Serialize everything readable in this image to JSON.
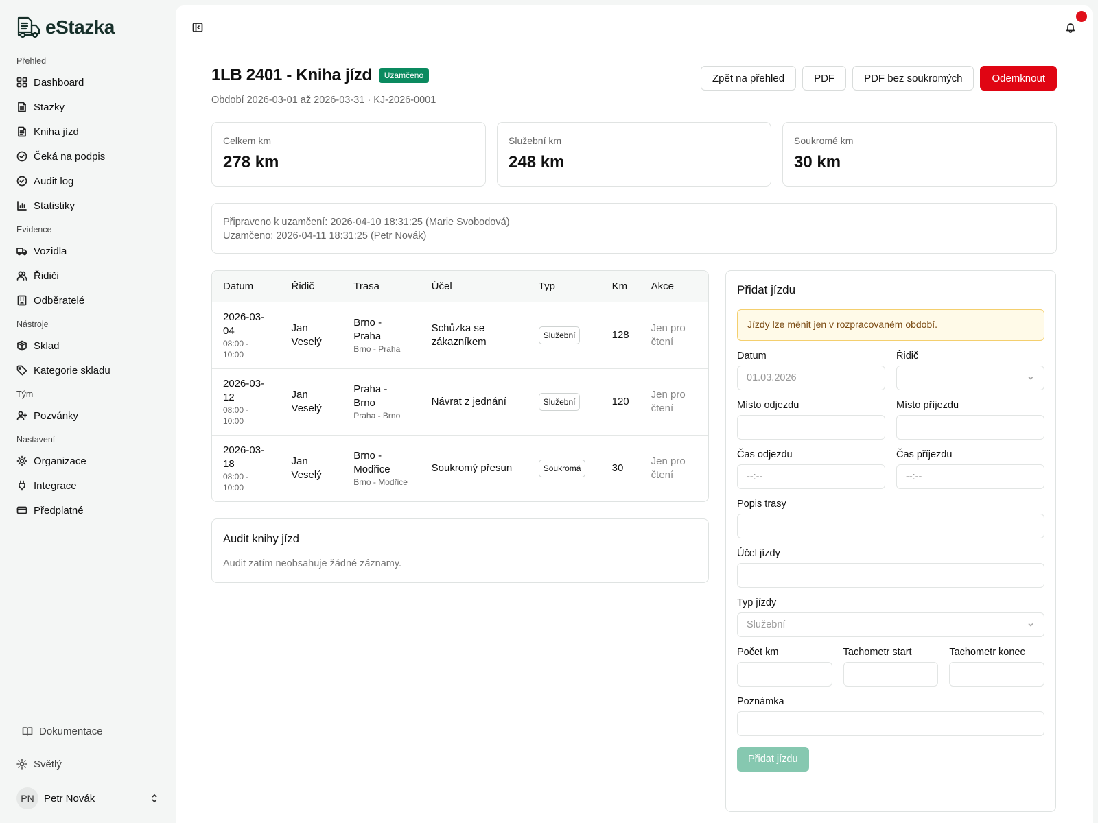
{
  "brand": {
    "name": "eStazka"
  },
  "sidebar": {
    "groups": [
      {
        "label": "Přehled",
        "items": [
          {
            "label": "Dashboard",
            "icon": "grid-icon"
          },
          {
            "label": "Stazky",
            "icon": "file-icon"
          },
          {
            "label": "Kniha jízd",
            "icon": "file-text-icon"
          },
          {
            "label": "Čeká na podpis",
            "icon": "check-circle-icon"
          },
          {
            "label": "Audit log",
            "icon": "check-circle-icon"
          },
          {
            "label": "Statistiky",
            "icon": "bar-chart-icon"
          }
        ]
      },
      {
        "label": "Evidence",
        "items": [
          {
            "label": "Vozidla",
            "icon": "truck-icon"
          },
          {
            "label": "Řidiči",
            "icon": "users-icon"
          },
          {
            "label": "Odběratelé",
            "icon": "building-icon"
          }
        ]
      },
      {
        "label": "Nástroje",
        "items": [
          {
            "label": "Sklad",
            "icon": "package-icon"
          },
          {
            "label": "Kategorie skladu",
            "icon": "tag-icon"
          }
        ]
      },
      {
        "label": "Tým",
        "items": [
          {
            "label": "Pozvánky",
            "icon": "user-plus-icon"
          }
        ]
      },
      {
        "label": "Nastavení",
        "items": [
          {
            "label": "Organizace",
            "icon": "gear-icon"
          },
          {
            "label": "Integrace",
            "icon": "plug-icon"
          },
          {
            "label": "Předplatné",
            "icon": "credit-card-icon"
          }
        ]
      }
    ],
    "docs_label": "Dokumentace",
    "theme_label": "Světlý",
    "user": {
      "initials": "PN",
      "name": "Petr Novák"
    }
  },
  "page": {
    "title": "1LB 2401 - Kniha jízd",
    "status": "Uzamčeno",
    "subtitle": "Období 2026-03-01 až 2026-03-31 · KJ-2026-0001",
    "actions": {
      "back": "Zpět na přehled",
      "pdf": "PDF",
      "pdf_private": "PDF bez soukromých",
      "unlock": "Odemknout"
    },
    "stats": [
      {
        "label": "Celkem km",
        "value": "278 km"
      },
      {
        "label": "Služební km",
        "value": "248 km"
      },
      {
        "label": "Soukromé km",
        "value": "30 km"
      }
    ],
    "info": {
      "prepared": "Připraveno k uzamčení: 2026-04-10 18:31:25 (Marie Svobodová)",
      "locked": "Uzamčeno: 2026-04-11 18:31:25 (Petr Novák)"
    },
    "colors": {
      "accent": "#0a8a5f",
      "danger": "#e00513",
      "warning_bg": "#fffae8"
    }
  },
  "table": {
    "headers": [
      "Datum",
      "Řidič",
      "Trasa",
      "Účel",
      "Typ",
      "Km",
      "Akce"
    ],
    "rows": [
      {
        "date": "2026-03-04",
        "time": "08:00 - 10:00",
        "driver": "Jan Veselý",
        "route": "Brno - Praha",
        "route_sub": "Brno - Praha",
        "purpose": "Schůzka se zákazníkem",
        "type": "Služební",
        "km": "128",
        "action": "Jen pro čtení"
      },
      {
        "date": "2026-03-12",
        "time": "08:00 - 10:00",
        "driver": "Jan Veselý",
        "route": "Praha - Brno",
        "route_sub": "Praha - Brno",
        "purpose": "Návrat z jednání",
        "type": "Služební",
        "km": "120",
        "action": "Jen pro čtení"
      },
      {
        "date": "2026-03-18",
        "time": "08:00 - 10:00",
        "driver": "Jan Veselý",
        "route": "Brno - Modřice",
        "route_sub": "Brno - Modřice",
        "purpose": "Soukromý přesun",
        "type": "Soukromá",
        "km": "30",
        "action": "Jen pro čtení"
      }
    ]
  },
  "audit": {
    "title": "Audit knihy jízd",
    "empty": "Audit zatím neobsahuje žádné záznamy."
  },
  "form": {
    "title": "Přidat jízdu",
    "warning": "Jízdy lze měnit jen v rozpracovaném období.",
    "date_label": "Datum",
    "date_value": "01.03.2026",
    "driver_label": "Řidič",
    "driver_value": "",
    "from_label": "Místo odjezdu",
    "to_label": "Místo příjezdu",
    "dep_time_label": "Čas odjezdu",
    "dep_time_placeholder": "--:--",
    "arr_time_label": "Čas příjezdu",
    "arr_time_placeholder": "--:--",
    "route_label": "Popis trasy",
    "purpose_label": "Účel jízdy",
    "type_label": "Typ jízdy",
    "type_value": "Služební",
    "km_label": "Počet km",
    "odo_start_label": "Tachometr start",
    "odo_end_label": "Tachometr konec",
    "note_label": "Poznámka",
    "submit": "Přidat jízdu"
  }
}
